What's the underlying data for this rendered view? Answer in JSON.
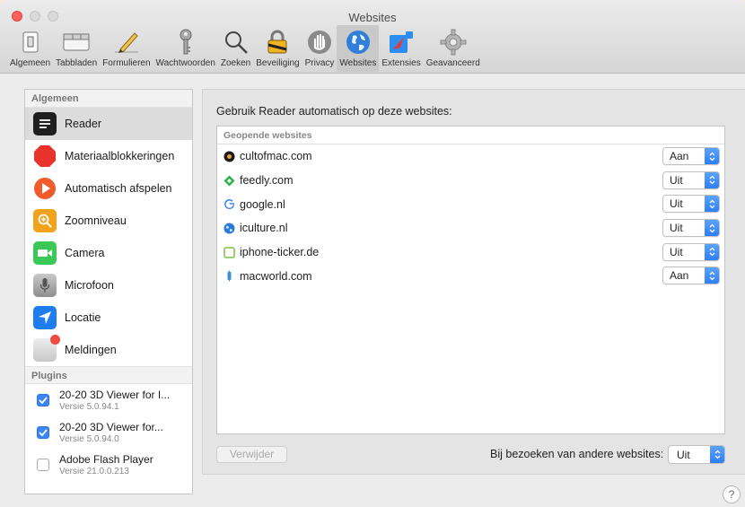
{
  "window": {
    "title": "Websites"
  },
  "toolbar": {
    "items": [
      {
        "label": "Algemeen",
        "icon": "switch-icon"
      },
      {
        "label": "Tabbladen",
        "icon": "tabs-icon"
      },
      {
        "label": "Formulieren",
        "icon": "pencil-icon"
      },
      {
        "label": "Wachtwoorden",
        "icon": "key-icon"
      },
      {
        "label": "Zoeken",
        "icon": "search-icon"
      },
      {
        "label": "Beveiliging",
        "icon": "padlock-icon"
      },
      {
        "label": "Privacy",
        "icon": "hand-icon"
      },
      {
        "label": "Websites",
        "icon": "globe-icon",
        "active": true
      },
      {
        "label": "Extensies",
        "icon": "puzzle-icon"
      },
      {
        "label": "Geavanceerd",
        "icon": "gear-icon"
      }
    ]
  },
  "sidebar": {
    "general_header": "Algemeen",
    "items": [
      {
        "label": "Reader",
        "icon": "reader-icon",
        "color": "#1f1f1f",
        "selected": true
      },
      {
        "label": "Materiaalblokkeringen",
        "icon": "stop-icon",
        "color": "#e8322c"
      },
      {
        "label": "Automatisch afspelen",
        "icon": "play-icon",
        "color": "#f15a2b"
      },
      {
        "label": "Zoomniveau",
        "icon": "zoom-icon",
        "color": "#f3a21b"
      },
      {
        "label": "Camera",
        "icon": "camera-icon",
        "color": "#3cc856"
      },
      {
        "label": "Microfoon",
        "icon": "microphone-icon",
        "color": "#9a9a9a"
      },
      {
        "label": "Locatie",
        "icon": "location-arrow-icon",
        "color": "#1e7ef0"
      },
      {
        "label": "Meldingen",
        "icon": "notifications-icon",
        "color": "#d8d8d8"
      }
    ],
    "plugins_header": "Plugins",
    "plugins": [
      {
        "name": "20-20 3D Viewer for I...",
        "version": "Versie 5.0.94.1",
        "checked": true
      },
      {
        "name": "20-20 3D Viewer for...",
        "version": "Versie 5.0.94.0",
        "checked": true
      },
      {
        "name": "Adobe Flash Player",
        "version": "Versie 21.0.0.213",
        "checked": false
      }
    ]
  },
  "main": {
    "heading": "Gebruik Reader automatisch op deze websites:",
    "list_header": "Geopende websites",
    "sites": [
      {
        "domain": "cultofmac.com",
        "value": "Aan",
        "icon": "cultofmac-favicon",
        "color": "#1a1a1a"
      },
      {
        "domain": "feedly.com",
        "value": "Uit",
        "icon": "feedly-favicon",
        "color": "#2bb24c"
      },
      {
        "domain": "google.nl",
        "value": "Uit",
        "icon": "google-favicon",
        "color": "#4285f4"
      },
      {
        "domain": "iculture.nl",
        "value": "Uit",
        "icon": "iculture-favicon",
        "color": "#2a7bd9"
      },
      {
        "domain": "iphone-ticker.de",
        "value": "Uit",
        "icon": "iphone-ticker-favicon",
        "color": "#7dc142"
      },
      {
        "domain": "macworld.com",
        "value": "Aan",
        "icon": "macworld-favicon",
        "color": "#3a8fd6"
      }
    ],
    "remove_button": "Verwijder",
    "other_label": "Bij bezoeken van andere websites:",
    "other_value": "Uit",
    "help": "?"
  }
}
